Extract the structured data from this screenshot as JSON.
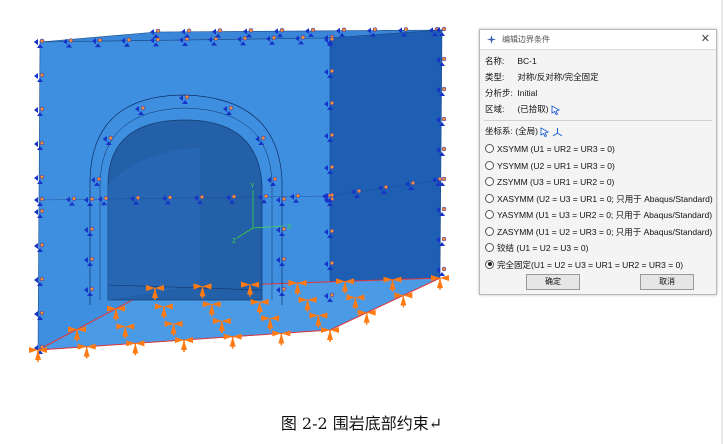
{
  "dialog": {
    "title": "编辑边界条件",
    "name_label": "名称:",
    "name_value": "BC-1",
    "type_label": "类型:",
    "type_value": "对称/反对称/完全固定",
    "step_label": "分析步:",
    "step_value": "Initial",
    "region_label": "区域:",
    "region_value": "(已拾取)",
    "csys_label": "坐标系:",
    "csys_value": "(全局)",
    "options": [
      "XSYMM (U1 = UR2 = UR3 = 0)",
      "YSYMM (U2 = UR1 = UR3 = 0)",
      "ZSYMM (U3 = UR1 = UR2 = 0)",
      "XASYMM (U2 = U3 = UR1 = 0; 只用于 Abaqus/Standard)",
      "YASYMM (U1 = U3 = UR2 = 0; 只用于 Abaqus/Standard)",
      "ZASYMM (U1 = U2 = UR3 = 0; 只用于 Abaqus/Standard)",
      "铰结 (U1 = U2 = U3 = 0)",
      "完全固定(U1 = U2 = U3 = UR1 = UR2 = UR3 = 0)"
    ],
    "selected_option": 7,
    "ok_label": "确定",
    "cancel_label": "取消"
  },
  "viewport": {
    "triad_labels": [
      "Y",
      "Z",
      "X"
    ],
    "colors": {
      "front": "#3f8fe0",
      "top": "#3a86d8",
      "side": "#1f5fb3",
      "tunnel": "#2360a8",
      "constraint_blue": "#1633c8",
      "constraint_orange": "#ff7a12",
      "edge_red": "#e0363a"
    }
  },
  "caption": "图 2-2  围岩底部约束↵"
}
